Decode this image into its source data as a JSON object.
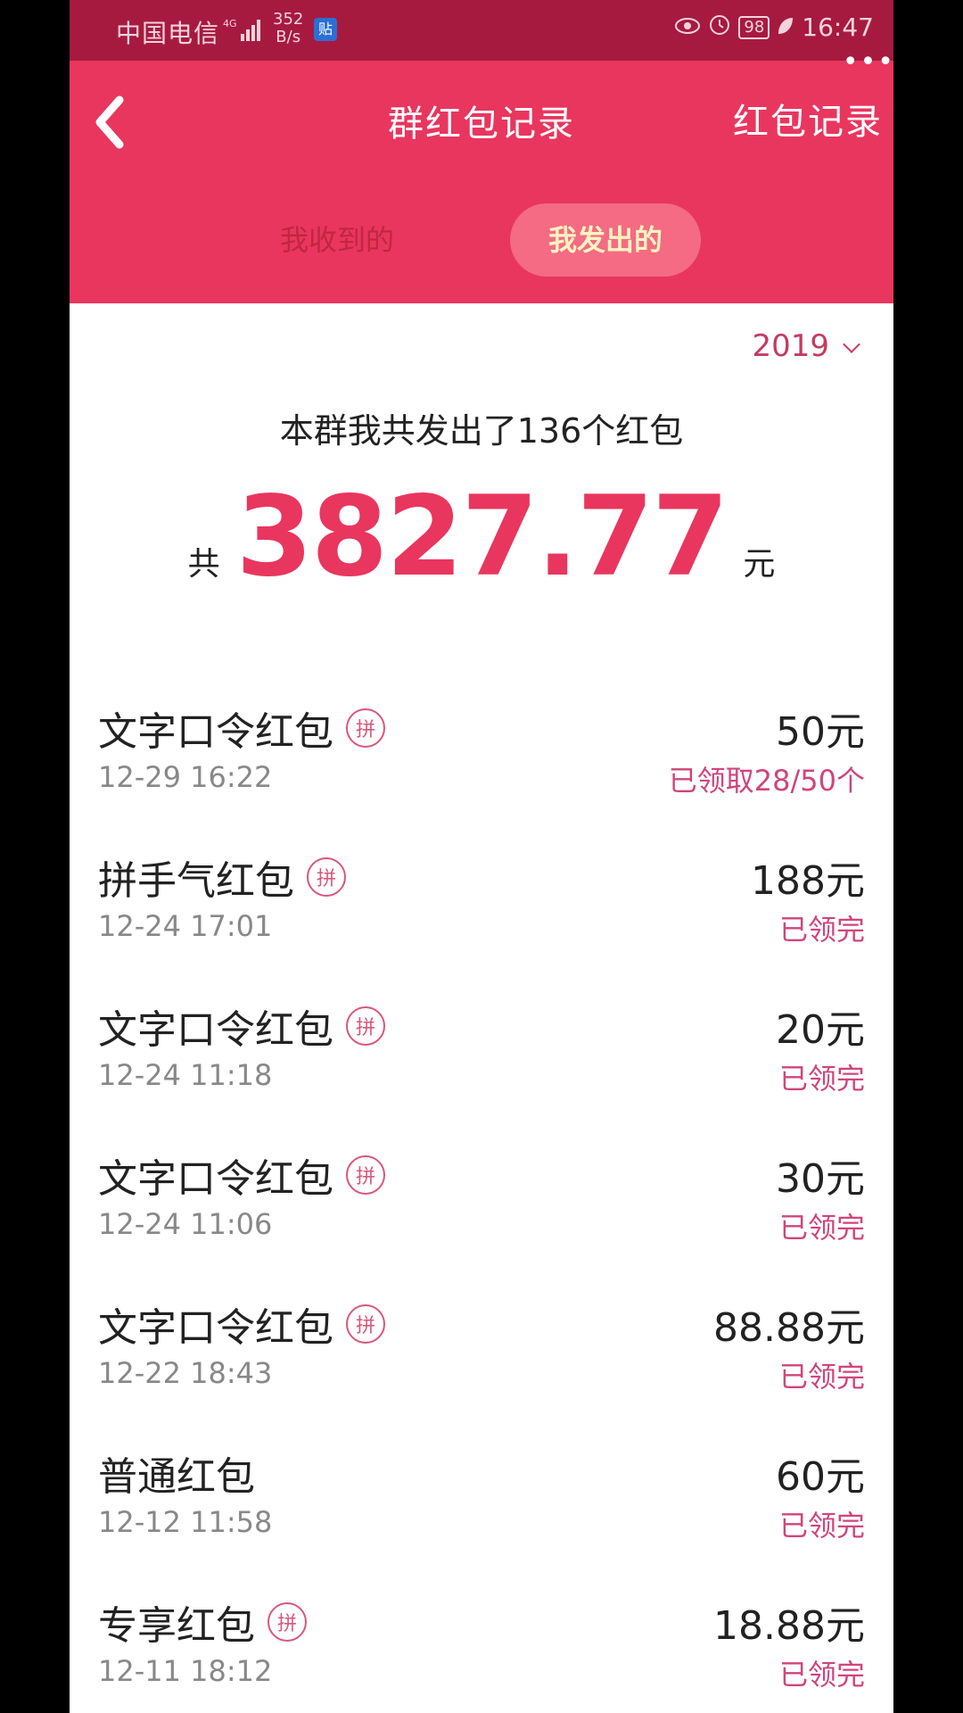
{
  "statusbar": {
    "carrier": "中国电信",
    "network": "4G",
    "speed_top": "352",
    "speed_bottom": "B/s",
    "app_icon": "贴",
    "battery": "98",
    "time": "16:47"
  },
  "header": {
    "title": "群红包记录",
    "right_link": "红包记录",
    "more": "•••",
    "tabs": [
      {
        "label": "我收到的",
        "active": false
      },
      {
        "label": "我发出的",
        "active": true
      }
    ],
    "colors": {
      "header_bg": "#e9365e",
      "status_bg": "#a71a3f",
      "active_tab_bg": "#f46b83"
    }
  },
  "filter": {
    "year": "2019"
  },
  "summary": {
    "text": "本群我共发出了136个红包",
    "prefix": "共",
    "amount": "3827.77",
    "unit": "元"
  },
  "records": [
    {
      "name": "文字口令红包",
      "badge": "拼",
      "time": "12-29 16:22",
      "amount": "50元",
      "status": "已领取28/50个"
    },
    {
      "name": "拼手气红包",
      "badge": "拼",
      "time": "12-24 17:01",
      "amount": "188元",
      "status": "已领完"
    },
    {
      "name": "文字口令红包",
      "badge": "拼",
      "time": "12-24 11:18",
      "amount": "20元",
      "status": "已领完"
    },
    {
      "name": "文字口令红包",
      "badge": "拼",
      "time": "12-24 11:06",
      "amount": "30元",
      "status": "已领完"
    },
    {
      "name": "文字口令红包",
      "badge": "拼",
      "time": "12-22 18:43",
      "amount": "88.88元",
      "status": "已领完"
    },
    {
      "name": "普通红包",
      "badge": "",
      "time": "12-12 11:58",
      "amount": "60元",
      "status": "已领完"
    },
    {
      "name": "专享红包",
      "badge": "拼",
      "time": "12-11 18:12",
      "amount": "18.88元",
      "status": "已领完"
    }
  ]
}
